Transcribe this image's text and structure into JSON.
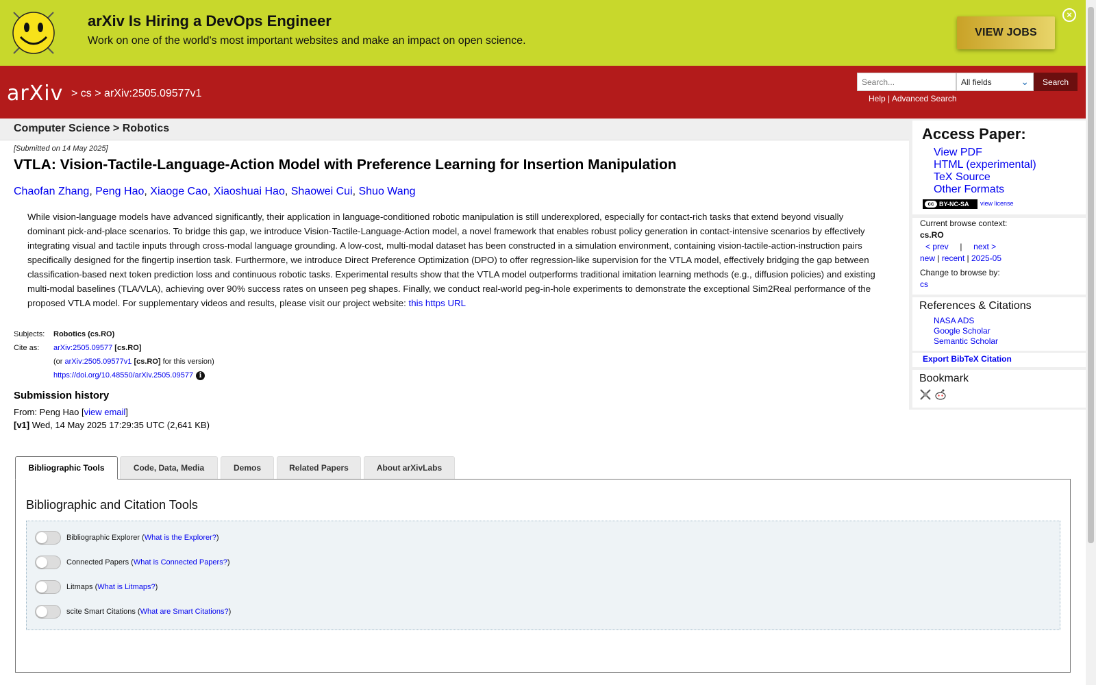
{
  "banner": {
    "title": "arXiv Is Hiring a DevOps Engineer",
    "subtitle": "Work on one of the world's most important websites and make an impact on open science.",
    "cta_label": "VIEW JOBS",
    "close_glyph": "×"
  },
  "header": {
    "logo_text": "arXiv",
    "breadcrumb": {
      "sep1": ">",
      "cs": "cs",
      "sep2": ">",
      "id": "arXiv:2505.09577v1"
    },
    "search": {
      "placeholder": "Search...",
      "field_value": "All fields",
      "button_label": "Search"
    },
    "help_label": "Help",
    "links_sep": " | ",
    "advanced_label": "Advanced Search"
  },
  "subheader": {
    "text": "Computer Science > Robotics"
  },
  "paper": {
    "dateline": "[Submitted on 14 May 2025]",
    "title": "VTLA: Vision-Tactile-Language-Action Model with Preference Learning for Insertion Manipulation",
    "authors": [
      "Chaofan Zhang",
      "Peng Hao",
      "Xiaoge Cao",
      "Xiaoshuai Hao",
      "Shaowei Cui",
      "Shuo Wang"
    ],
    "abstract": "While vision-language models have advanced significantly, their application in language-conditioned robotic manipulation is still underexplored, especially for contact-rich tasks that extend beyond visually dominant pick-and-place scenarios. To bridge this gap, we introduce Vision-Tactile-Language-Action model, a novel framework that enables robust policy generation in contact-intensive scenarios by effectively integrating visual and tactile inputs through cross-modal language grounding. A low-cost, multi-modal dataset has been constructed in a simulation environment, containing vision-tactile-action-instruction pairs specifically designed for the fingertip insertion task. Furthermore, we introduce Direct Preference Optimization (DPO) to offer regression-like supervision for the VTLA model, effectively bridging the gap between classification-based next token prediction loss and continuous robotic tasks. Experimental results show that the VTLA model outperforms traditional imitation learning methods (e.g., diffusion policies) and existing multi-modal baselines (TLA/VLA), achieving over 90% success rates on unseen peg shapes. Finally, we conduct real-world peg-in-hole experiments to demonstrate the exceptional Sim2Real performance of the proposed VTLA model. For supplementary videos and results, please visit our project website: ",
    "abstract_link": "this https URL",
    "subjects_label": "Subjects:",
    "subjects_value": "Robotics (cs.RO)",
    "cite_label": "Cite as:",
    "cite_id": "arXiv:2505.09577",
    "cite_cat": "[cs.RO]",
    "cite_or_prefix": "(or",
    "cite_version_id": "arXiv:2505.09577v1",
    "cite_version_cat": "[cs.RO]",
    "cite_version_suffix": "for this version)",
    "doi": "https://doi.org/10.48550/arXiv.2505.09577",
    "info_glyph": "i"
  },
  "history": {
    "title": "Submission history",
    "from_prefix": "From: Peng Hao [",
    "from_link": "view email",
    "from_suffix": "]",
    "v1_label": "[v1]",
    "v1_text": " Wed, 14 May 2025 17:29:35 UTC (2,641 KB)"
  },
  "sidebar": {
    "access_title": "Access Paper:",
    "access_links": [
      "View PDF",
      "HTML (experimental)",
      "TeX Source",
      "Other Formats"
    ],
    "cc_glyph": "cc",
    "license_badge": "BY-NC-SA",
    "view_license": "view license",
    "browse_context_label": "Current browse context:",
    "browse_context_value": "cs.RO",
    "prev": "< prev",
    "nav_sep": "|",
    "next": "next >",
    "new": "new",
    "recent": "recent",
    "month": "2025-05",
    "change_label": "Change to browse by:",
    "change_value": "cs",
    "refs_title": "References & Citations",
    "refs_links": [
      "NASA ADS",
      "Google Scholar",
      "Semantic Scholar"
    ],
    "bibtex": "Export BibTeX Citation",
    "bookmark_title": "Bookmark"
  },
  "tabs": {
    "items": [
      "Bibliographic Tools",
      "Code, Data, Media",
      "Demos",
      "Related Papers",
      "About arXivLabs"
    ],
    "panel_title": "Bibliographic and Citation Tools",
    "tools": [
      {
        "label": "Bibliographic Explorer",
        "link": "What is the Explorer?"
      },
      {
        "label": "Connected Papers",
        "link": "What is Connected Papers?"
      },
      {
        "label": "Litmaps",
        "link": "What is Litmaps?"
      },
      {
        "label": "scite Smart Citations",
        "link": "What are Smart Citations?"
      }
    ]
  },
  "colors": {
    "header": "#b31b1b",
    "banner": "#c8d82c",
    "link": "#0000ee"
  }
}
